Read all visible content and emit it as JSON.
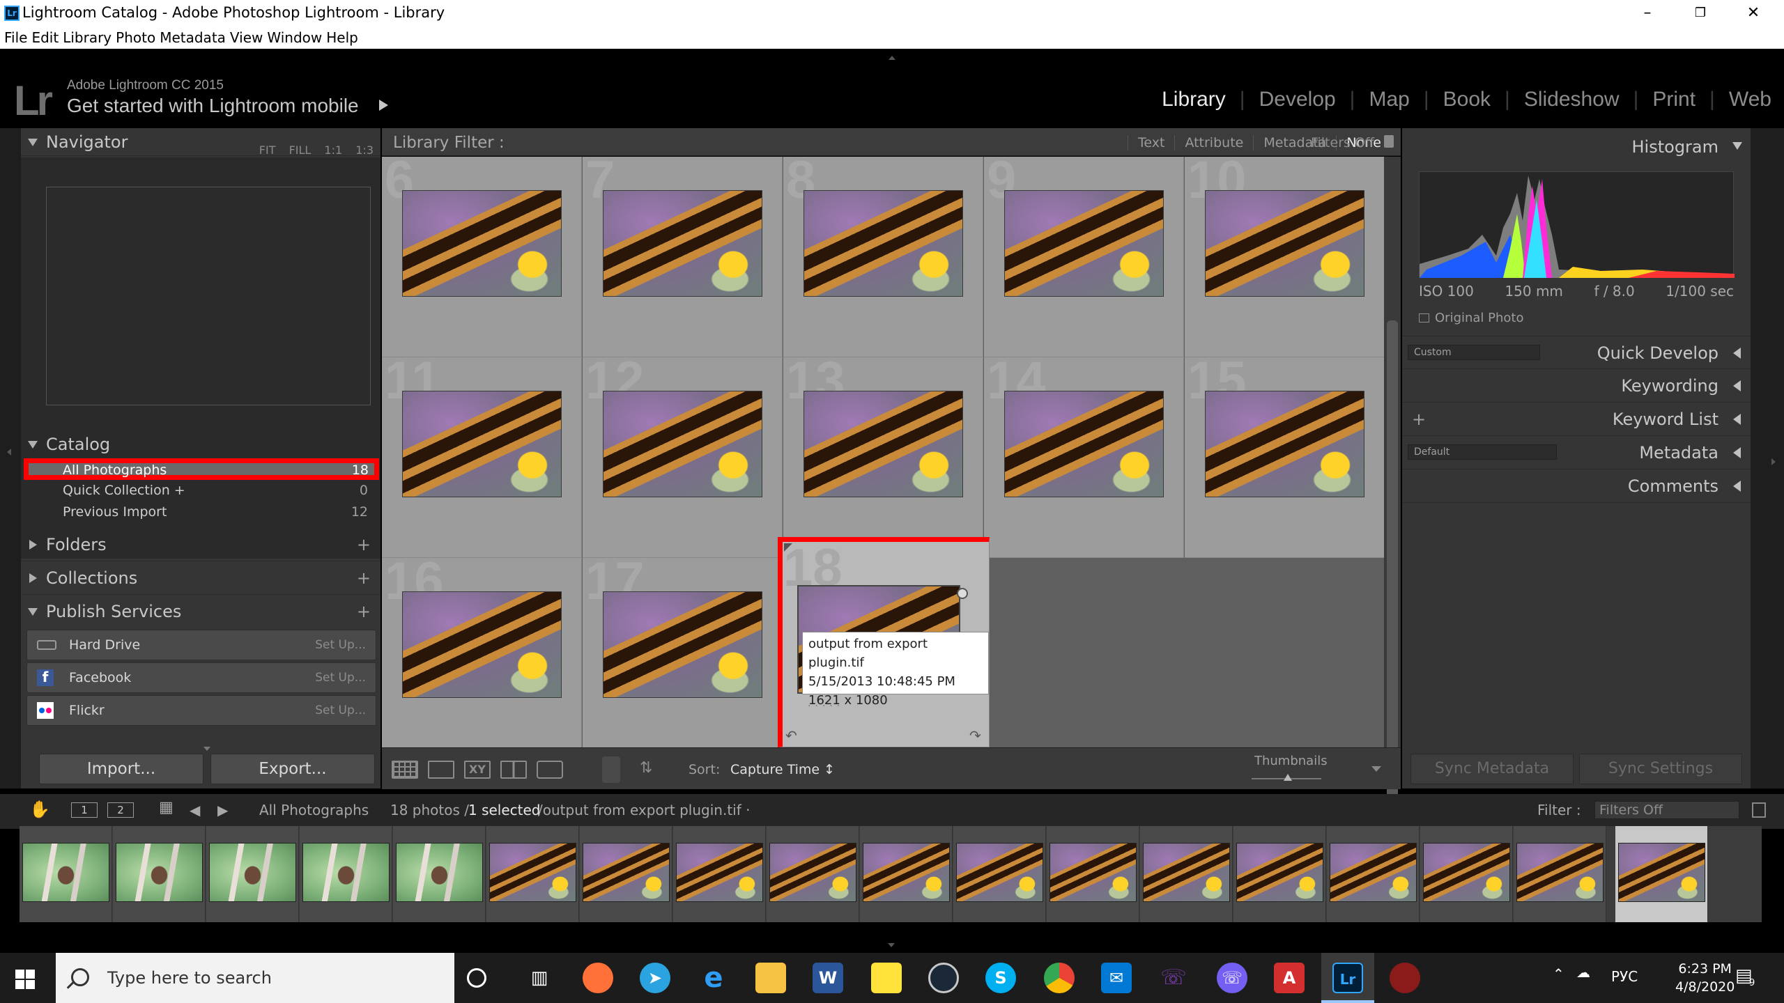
{
  "window": {
    "title": "Lightroom Catalog - Adobe Photoshop Lightroom - Library",
    "app_icon": "Lr",
    "controls": [
      "minimize",
      "restore",
      "close"
    ]
  },
  "menu": [
    "File",
    "Edit",
    "Library",
    "Photo",
    "Metadata",
    "View",
    "Window",
    "Help"
  ],
  "identity": {
    "logo": "Lr",
    "subtitle": "Adobe Lightroom CC 2015",
    "main": "Get started with Lightroom mobile"
  },
  "modules": [
    "Library",
    "Develop",
    "Map",
    "Book",
    "Slideshow",
    "Print",
    "Web"
  ],
  "active_module": "Library",
  "navigator": {
    "title": "Navigator",
    "zoom": [
      "FIT",
      "FILL",
      "1:1",
      "1:3"
    ]
  },
  "catalog": {
    "title": "Catalog",
    "items": [
      {
        "label": "All Photographs",
        "count": "18"
      },
      {
        "label": "Quick Collection +",
        "count": "0"
      },
      {
        "label": "Previous Import",
        "count": "12"
      }
    ]
  },
  "sections": {
    "folders": "Folders",
    "collections": "Collections",
    "publish": "Publish Services"
  },
  "publish_services": [
    {
      "label": "Hard Drive",
      "action": "Set Up..."
    },
    {
      "label": "Facebook",
      "action": "Set Up..."
    },
    {
      "label": "Flickr",
      "action": "Set Up..."
    }
  ],
  "buttons": {
    "import": "Import...",
    "export": "Export..."
  },
  "filter_bar": {
    "label": "Library Filter :",
    "options": [
      "Text",
      "Attribute",
      "Metadata",
      "None"
    ],
    "active": "None",
    "status": "Filters Off"
  },
  "grid": {
    "cells": [
      {
        "num": "6"
      },
      {
        "num": "7"
      },
      {
        "num": "8"
      },
      {
        "num": "9"
      },
      {
        "num": "10"
      },
      {
        "num": "11"
      },
      {
        "num": "12"
      },
      {
        "num": "13"
      },
      {
        "num": "14"
      },
      {
        "num": "15"
      },
      {
        "num": "16"
      },
      {
        "num": "17"
      },
      {
        "num": "18"
      }
    ],
    "selected": "18"
  },
  "tooltip": {
    "filename": "output from export plugin.tif",
    "date": "5/15/2013 10:48:45 PM",
    "dimensions": "1621 x 1080"
  },
  "toolbar": {
    "sort_label": "Sort:",
    "sort_value": "Capture Time ↕",
    "thumbnails_label": "Thumbnails"
  },
  "histogram": {
    "title": "Histogram",
    "iso": "ISO 100",
    "focal": "150 mm",
    "aperture": "f / 8.0",
    "shutter": "1/100 sec",
    "original_photo": "Original Photo"
  },
  "right_panels": [
    {
      "label": "Quick Develop",
      "preset": "Custom"
    },
    {
      "label": "Keywording"
    },
    {
      "label": "Keyword List"
    },
    {
      "label": "Metadata",
      "preset": "Default"
    },
    {
      "label": "Comments"
    }
  ],
  "right_buttons": {
    "sync_metadata": "Sync Metadata",
    "sync_settings": "Sync Settings"
  },
  "filmstrip_header": {
    "monitor1": "1",
    "monitor2": "2",
    "source": "All Photographs",
    "count_text": "18 photos /",
    "selected_text": "1 selected",
    "path": "/output from export plugin.tif ·",
    "filter_label": "Filter :",
    "filter_value": "Filters Off"
  },
  "taskbar": {
    "search_placeholder": "Type here to search",
    "lang": "РУС",
    "time": "6:23 PM",
    "date": "4/8/2020",
    "notification_count": "9",
    "apps": [
      "firefox",
      "telegram",
      "edge",
      "explorer",
      "word",
      "sticky-notes",
      "steam",
      "skype",
      "chrome",
      "mail",
      "viber",
      "viber-2",
      "acrobat",
      "lightroom",
      "game"
    ]
  }
}
